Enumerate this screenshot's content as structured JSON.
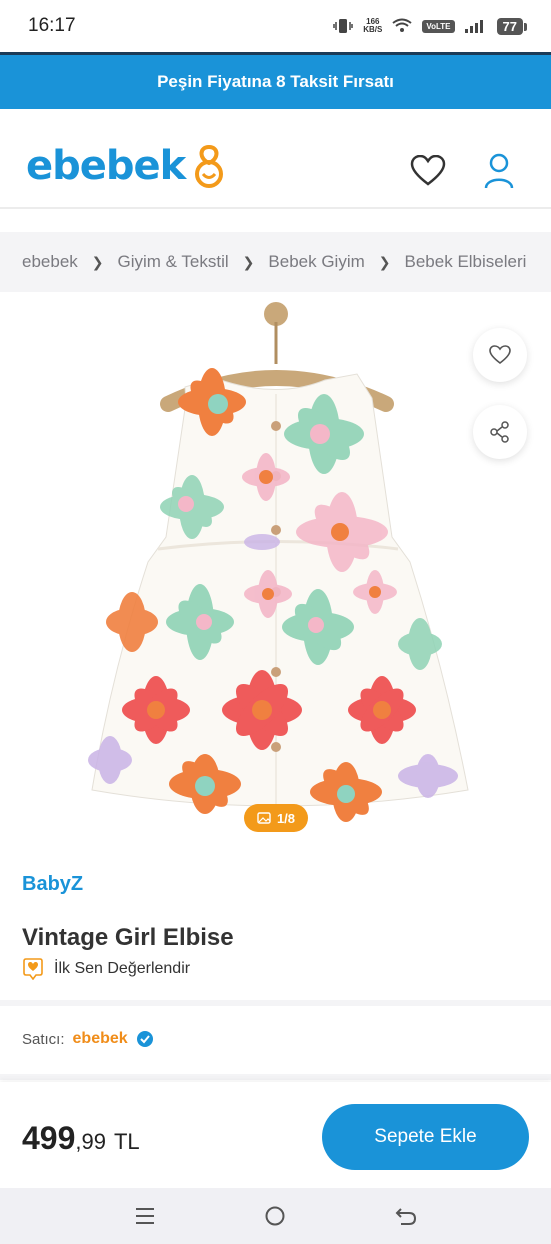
{
  "status": {
    "time": "16:17",
    "net_speed_value": "166",
    "net_speed_unit": "KB/S",
    "volte": "VoLTE",
    "battery": "77"
  },
  "promo": {
    "text": "Peşin Fiyatına 8 Taksit Fırsatı"
  },
  "header": {
    "logo": "ebebek"
  },
  "breadcrumb": [
    "ebebek",
    "Giyim & Tekstil",
    "Bebek Giyim",
    "Bebek Elbiseleri"
  ],
  "gallery": {
    "counter": "1/8"
  },
  "product": {
    "brand": "BabyZ",
    "title": "Vintage Girl Elbise",
    "rate_text": "İlk Sen Değerlendir",
    "seller_label": "Satıcı:",
    "seller_name": "ebebek"
  },
  "footer": {
    "price_main": "499",
    "price_frac": ",99",
    "currency": "TL",
    "cart_button": "Sepete Ekle"
  },
  "colors": {
    "brand_blue": "#1a93d8",
    "accent_orange": "#f39a1a"
  }
}
